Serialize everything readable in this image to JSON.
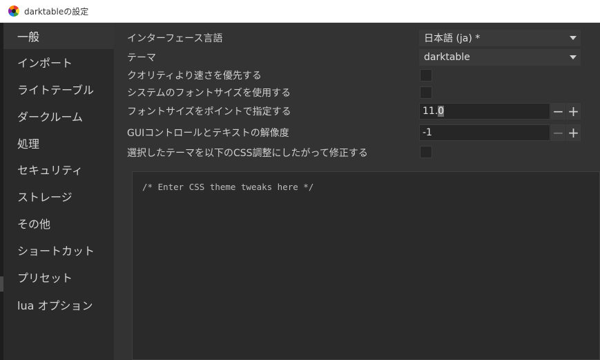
{
  "window": {
    "title": "darktableの設定",
    "app_icon": "darktable-logo-icon"
  },
  "sidebar": {
    "items": [
      {
        "label": "一般",
        "active": true
      },
      {
        "label": "インポート",
        "active": false
      },
      {
        "label": "ライトテーブル",
        "active": false
      },
      {
        "label": "ダークルーム",
        "active": false
      },
      {
        "label": "処理",
        "active": false
      },
      {
        "label": "セキュリティ",
        "active": false
      },
      {
        "label": "ストレージ",
        "active": false
      },
      {
        "label": "その他",
        "active": false
      },
      {
        "label": "ショートカット",
        "active": false
      },
      {
        "label": "プリセット",
        "active": false
      },
      {
        "label": "lua オプション",
        "active": false
      }
    ]
  },
  "settings": {
    "language": {
      "label": "インターフェース言語",
      "value": "日本語 (ja) *"
    },
    "theme": {
      "label": "テーマ",
      "value": "darktable"
    },
    "prefer_speed": {
      "label": "クオリティより速さを優先する",
      "checked": false
    },
    "system_font": {
      "label": "システムのフォントサイズを使用する",
      "checked": false
    },
    "font_size": {
      "label": "フォントサイズをポイントで指定する",
      "value_main": "11.",
      "value_selected": "0",
      "minus": "−",
      "plus": "+"
    },
    "gui_dpi": {
      "label": "GUIコントロールとテキストの解像度",
      "value": "-1",
      "minus": "−",
      "plus": "+"
    },
    "css_tweaks": {
      "label": "選択したテーマを以下のCSS調整にしたがって修正する",
      "checked": false
    },
    "css_editor_text": "/* Enter CSS theme tweaks here */"
  },
  "colors": {
    "background": "#333333",
    "sidebar": "#2a2a2a",
    "active_item": "#353535",
    "text": "#cfcfcf"
  }
}
